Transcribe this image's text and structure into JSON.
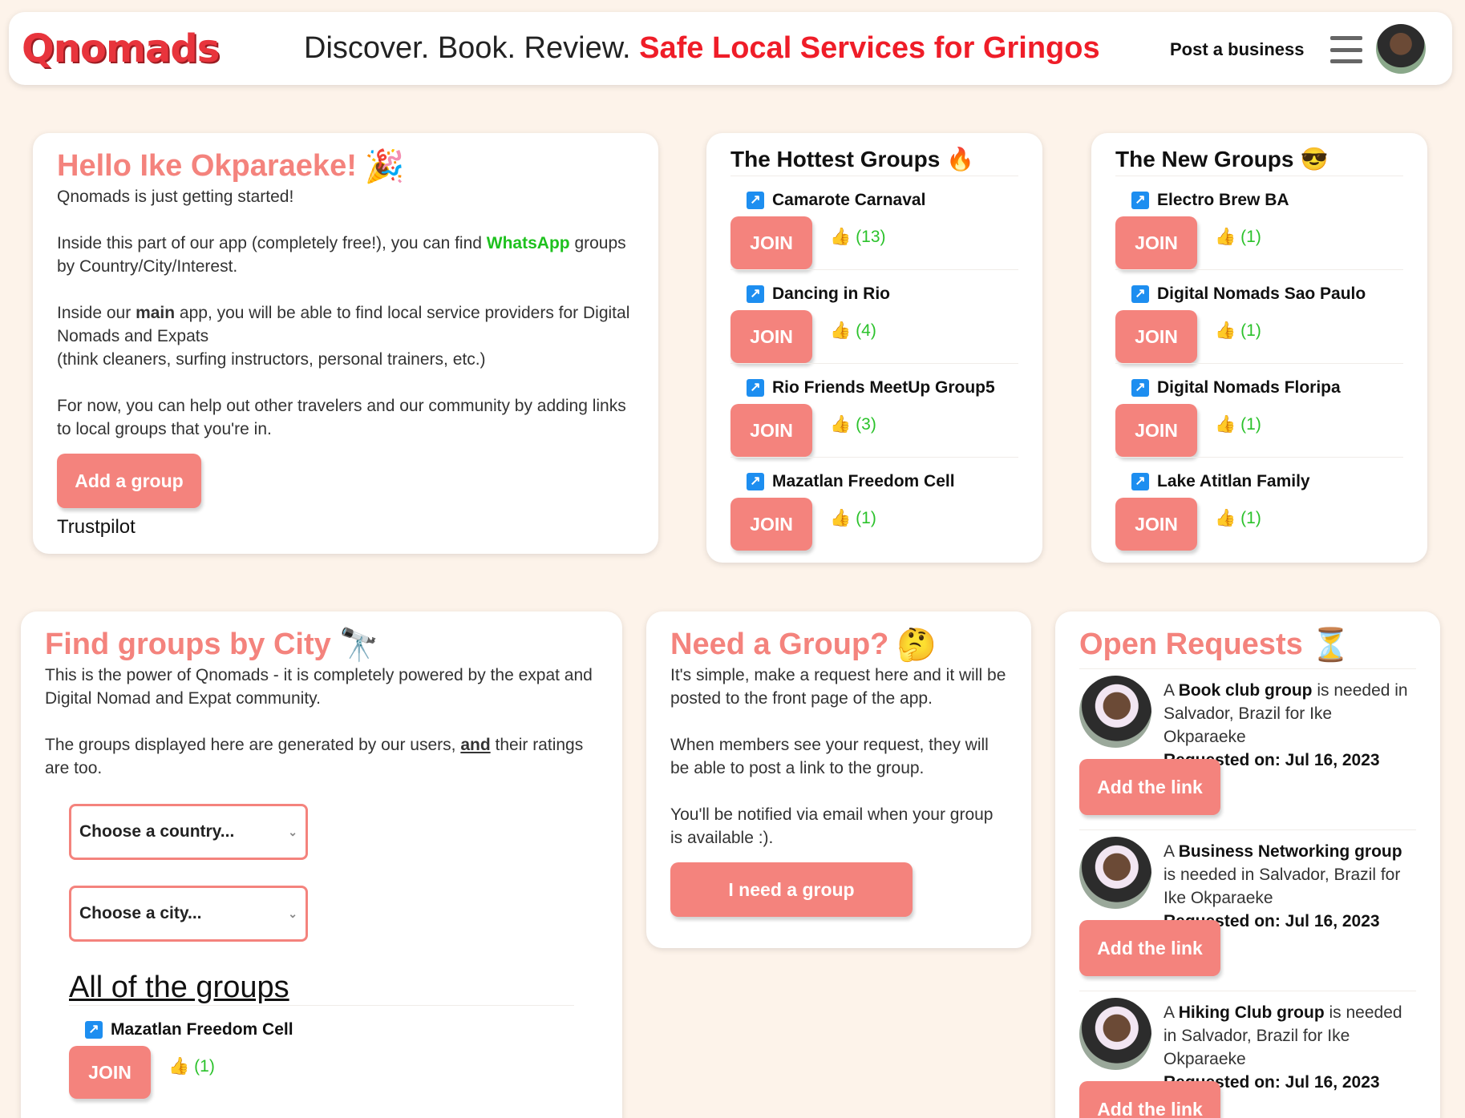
{
  "header": {
    "logo": "Qnomads",
    "tagline_plain": "Discover. Book. Review.",
    "tagline_accent": "Safe Local Services for Gringos",
    "post_link": "Post a business"
  },
  "hello": {
    "title": "Hello Ike Okparaeke!",
    "emoji": "🎉",
    "line1": "Qnomads is just getting started!",
    "p2a": "Inside this part of our app (completely free!), you can find ",
    "p2_accent": "WhatsApp",
    "p2b": " groups by Country/City/Interest.",
    "p3a": "Inside our ",
    "p3_bold": "main",
    "p3b": " app, you will be able to find local service providers for Digital Nomads and Expats",
    "p3c": "(think cleaners, surfing instructors, personal trainers, etc.)",
    "p4": "For now, you can help out other travelers and our community by adding links to local groups that you're in.",
    "button": "Add a group",
    "trustpilot": "Trustpilot"
  },
  "hottest": {
    "title": "The Hottest Groups",
    "emoji": "🔥",
    "join_label": "JOIN",
    "items": [
      {
        "name": "Camarote Carnaval",
        "likes": "(13)"
      },
      {
        "name": "Dancing in Rio",
        "likes": "(4)"
      },
      {
        "name": "Rio Friends MeetUp Group5",
        "likes": "(3)"
      },
      {
        "name": "Mazatlan Freedom Cell",
        "likes": "(1)"
      }
    ]
  },
  "newest": {
    "title": "The New Groups",
    "emoji": "😎",
    "join_label": "JOIN",
    "items": [
      {
        "name": "Electro Brew BA",
        "likes": "(1)"
      },
      {
        "name": "Digital Nomads Sao Paulo",
        "likes": "(1)"
      },
      {
        "name": "Digital Nomads Floripa",
        "likes": "(1)"
      },
      {
        "name": "Lake Atitlan Family",
        "likes": "(1)"
      }
    ]
  },
  "find": {
    "title": "Find groups by City",
    "emoji": "🔭",
    "p1": "This is the power of Qnomads - it is completely powered by the expat and Digital Nomad and Expat community.",
    "p2a": "The groups displayed here are generated by our users, ",
    "p2_under": "and",
    "p2b": " their ratings are too.",
    "country_select": "Choose a country...",
    "city_select": "Choose a city...",
    "all_groups": "All of the groups",
    "join_label": "JOIN",
    "group": {
      "name": "Mazatlan Freedom Cell",
      "likes": "(1)"
    }
  },
  "need": {
    "title": "Need a Group?",
    "emoji": "🤔",
    "p1": "It's simple, make a request here and it will be posted to the front page of the app.",
    "p2": "When members see your request, they will be able to post a link to the group.",
    "p3": "You'll be notified via email when your group is available :).",
    "button": "I need a group"
  },
  "open": {
    "title": "Open Requests",
    "emoji": "⏳",
    "button": "Add the link",
    "requested_label": "Requested on: Jul 16, 2023",
    "items": [
      {
        "pre": "A ",
        "group": "Book club group",
        "post": " is needed in Salvador, Brazil for Ike Okparaeke"
      },
      {
        "pre": "A ",
        "group": "Business Networking group",
        "post": " is needed in Salvador, Brazil for Ike Okparaeke"
      },
      {
        "pre": "A ",
        "group": "Hiking Club group",
        "post": " is needed in Salvador, Brazil for Ike Okparaeke"
      }
    ]
  }
}
